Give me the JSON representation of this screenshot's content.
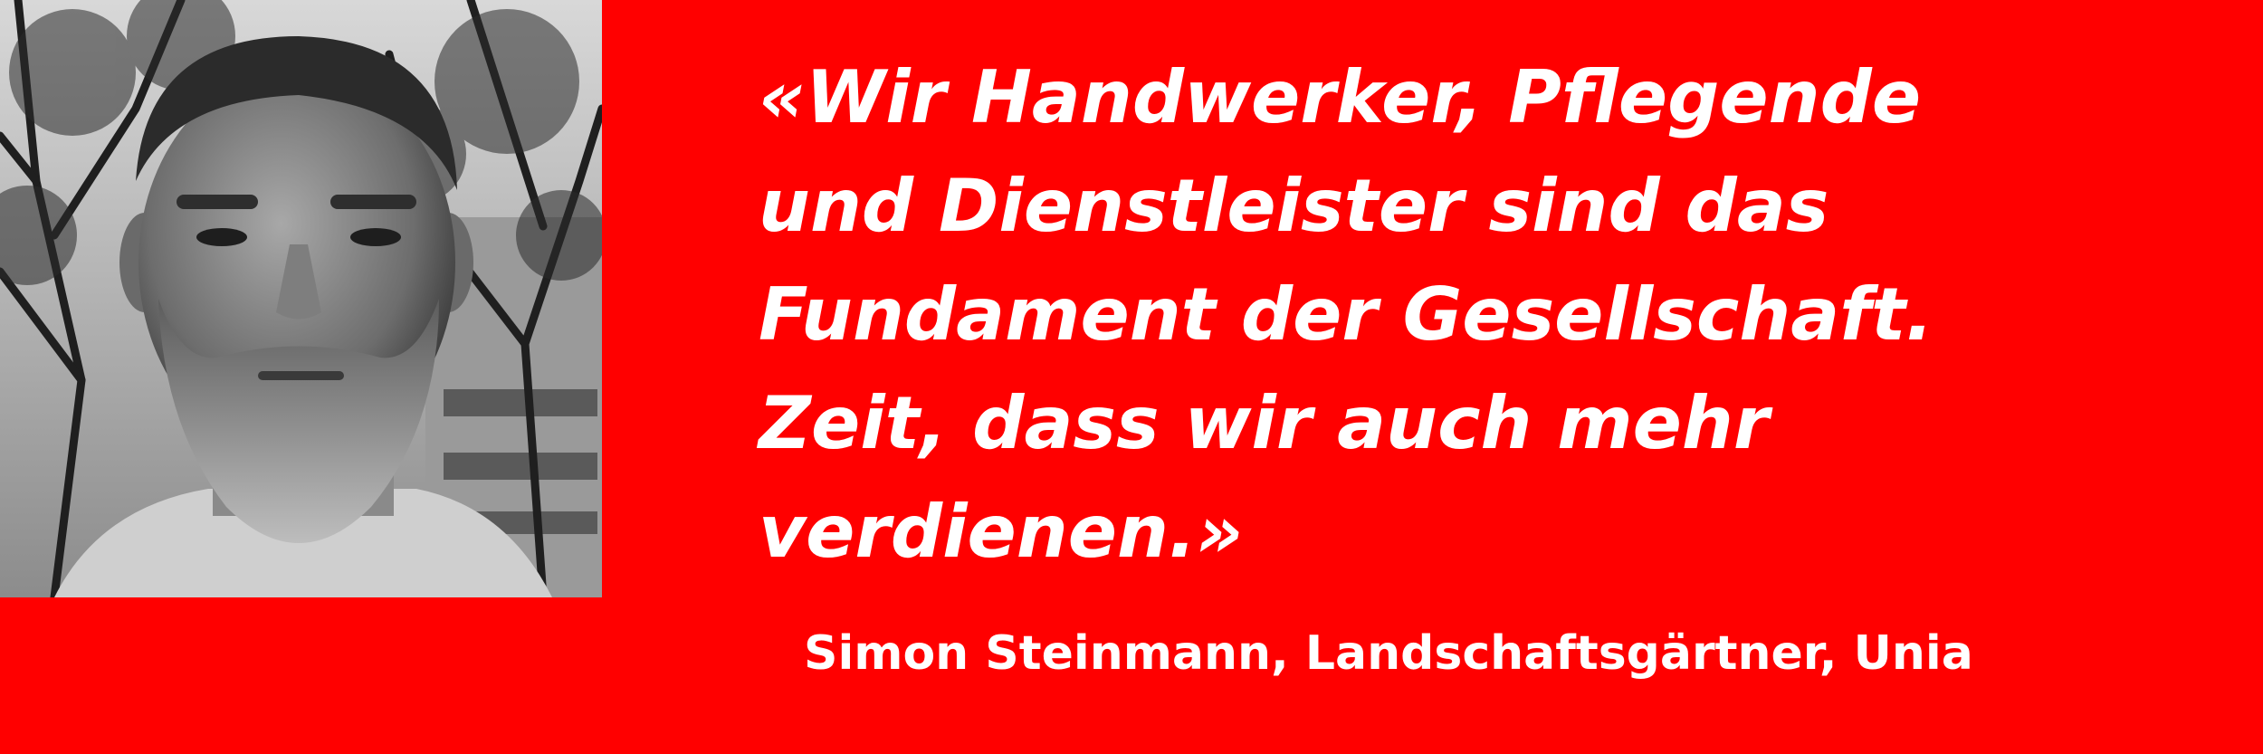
{
  "colors": {
    "background": "#ff0000",
    "text": "#ffffff"
  },
  "portrait": {
    "icon": "person-photo"
  },
  "quote": {
    "lines": [
      "«Wir Handwerker, Pflegende",
      "und Dienstleister sind das",
      "Fundament der Gesellschaft.",
      "Zeit, dass wir auch mehr",
      "verdienen.»"
    ]
  },
  "attribution": "Simon Steinmann, Landschaftsgärtner, Unia"
}
